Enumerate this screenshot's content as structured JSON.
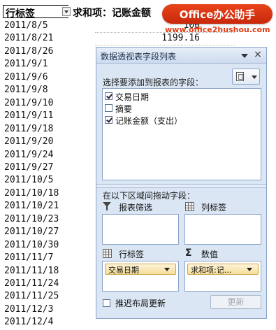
{
  "sheet": {
    "row_label_header": "行标签",
    "sum_header": "求和项：记账金额",
    "rows": [
      {
        "date": "2011/8/5",
        "amount": "100"
      },
      {
        "date": "2011/8/21",
        "amount": "1199.16"
      },
      {
        "date": "2011/8/26",
        "amount": ""
      },
      {
        "date": "2011/9/1",
        "amount": ""
      },
      {
        "date": "2011/9/6",
        "amount": ""
      },
      {
        "date": "2011/9/8",
        "amount": ""
      },
      {
        "date": "2011/9/10",
        "amount": ""
      },
      {
        "date": "2011/9/11",
        "amount": ""
      },
      {
        "date": "2011/9/18",
        "amount": ""
      },
      {
        "date": "2011/9/20",
        "amount": ""
      },
      {
        "date": "2011/9/24",
        "amount": ""
      },
      {
        "date": "2011/9/27",
        "amount": ""
      },
      {
        "date": "2011/10/5",
        "amount": ""
      },
      {
        "date": "2011/10/18",
        "amount": ""
      },
      {
        "date": "2011/10/21",
        "amount": ""
      },
      {
        "date": "2011/10/23",
        "amount": ""
      },
      {
        "date": "2011/10/27",
        "amount": ""
      },
      {
        "date": "2011/10/30",
        "amount": ""
      },
      {
        "date": "2011/11/7",
        "amount": ""
      },
      {
        "date": "2011/11/18",
        "amount": ""
      },
      {
        "date": "2011/11/24",
        "amount": ""
      },
      {
        "date": "2011/11/25",
        "amount": ""
      },
      {
        "date": "2011/12/3",
        "amount": ""
      },
      {
        "date": "2011/12/4",
        "amount": ""
      }
    ]
  },
  "watermark": {
    "logo_text": "Office办公助手",
    "url": "www.office2hushou.com"
  },
  "pane": {
    "title": "数据透视表字段列表",
    "close_glyph": "×",
    "select_label": "选择要添加到报表的字段：",
    "fields": [
      {
        "label": "交易日期",
        "checked": true
      },
      {
        "label": "摘要",
        "checked": false
      },
      {
        "label": "记账金额（支出）",
        "checked": true
      }
    ],
    "drag_label": "在以下区域间拖动字段：",
    "areas": {
      "filter": {
        "label": "报表筛选"
      },
      "columns": {
        "label": "列标签"
      },
      "rows": {
        "label": "行标签",
        "pill": "交易日期"
      },
      "values": {
        "label": "数值",
        "pill": "求和项:记..."
      }
    },
    "sigma_glyph": "Σ",
    "defer_label": "推迟布局更新",
    "update_label": "更新"
  },
  "colors": {
    "pane_bg": "#dbe6f4",
    "pill_bg": "#f7de9a",
    "logo_bg": "#d8330f"
  }
}
